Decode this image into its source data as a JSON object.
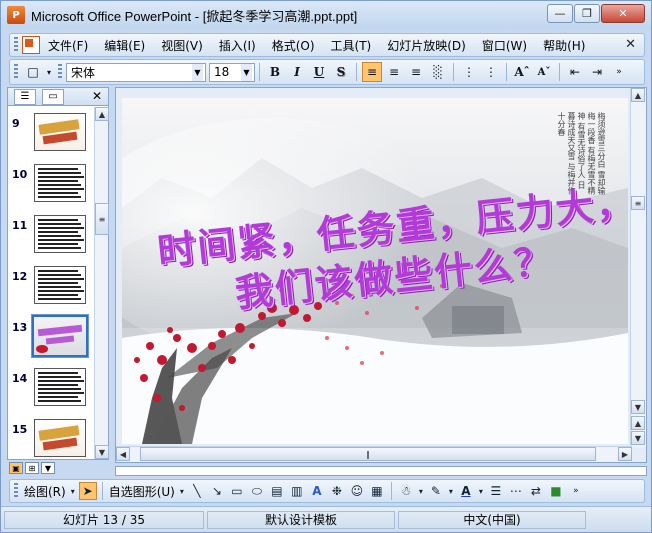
{
  "window": {
    "title": "Microsoft Office PowerPoint - [掀起冬季学习高潮.ppt.ppt]",
    "app_icon": "P"
  },
  "menu": {
    "items": [
      "文件(F)",
      "编辑(E)",
      "视图(V)",
      "插入(I)",
      "格式(O)",
      "工具(T)",
      "幻灯片放映(D)",
      "窗口(W)",
      "帮助(H)"
    ]
  },
  "formatting": {
    "font_name": "宋体",
    "font_size": "18",
    "bold": "B",
    "italic": "I",
    "underline": "U",
    "shadow": "S"
  },
  "slides_panel": {
    "slides": [
      {
        "num": "9",
        "kind": "title"
      },
      {
        "num": "10",
        "kind": "text"
      },
      {
        "num": "11",
        "kind": "text"
      },
      {
        "num": "12",
        "kind": "text"
      },
      {
        "num": "13",
        "kind": "selected"
      },
      {
        "num": "14",
        "kind": "text"
      },
      {
        "num": "15",
        "kind": "title"
      }
    ]
  },
  "slide": {
    "line1": "时间紧，任务重，压力大，",
    "line2": "我们该做些什么？",
    "poem": "梅须逊雪三分白 雪却输梅一段香 有梅无雪不精神 有雪无诗俗了人 日暮诗成天又雪 与梅并作十分春"
  },
  "drawing": {
    "draw_label": "绘图(R)",
    "autoshape_label": "自选图形(U)"
  },
  "status": {
    "slide_info": "幻灯片 13 / 35",
    "template": "默认设计模板",
    "language": "中文(中国)"
  }
}
